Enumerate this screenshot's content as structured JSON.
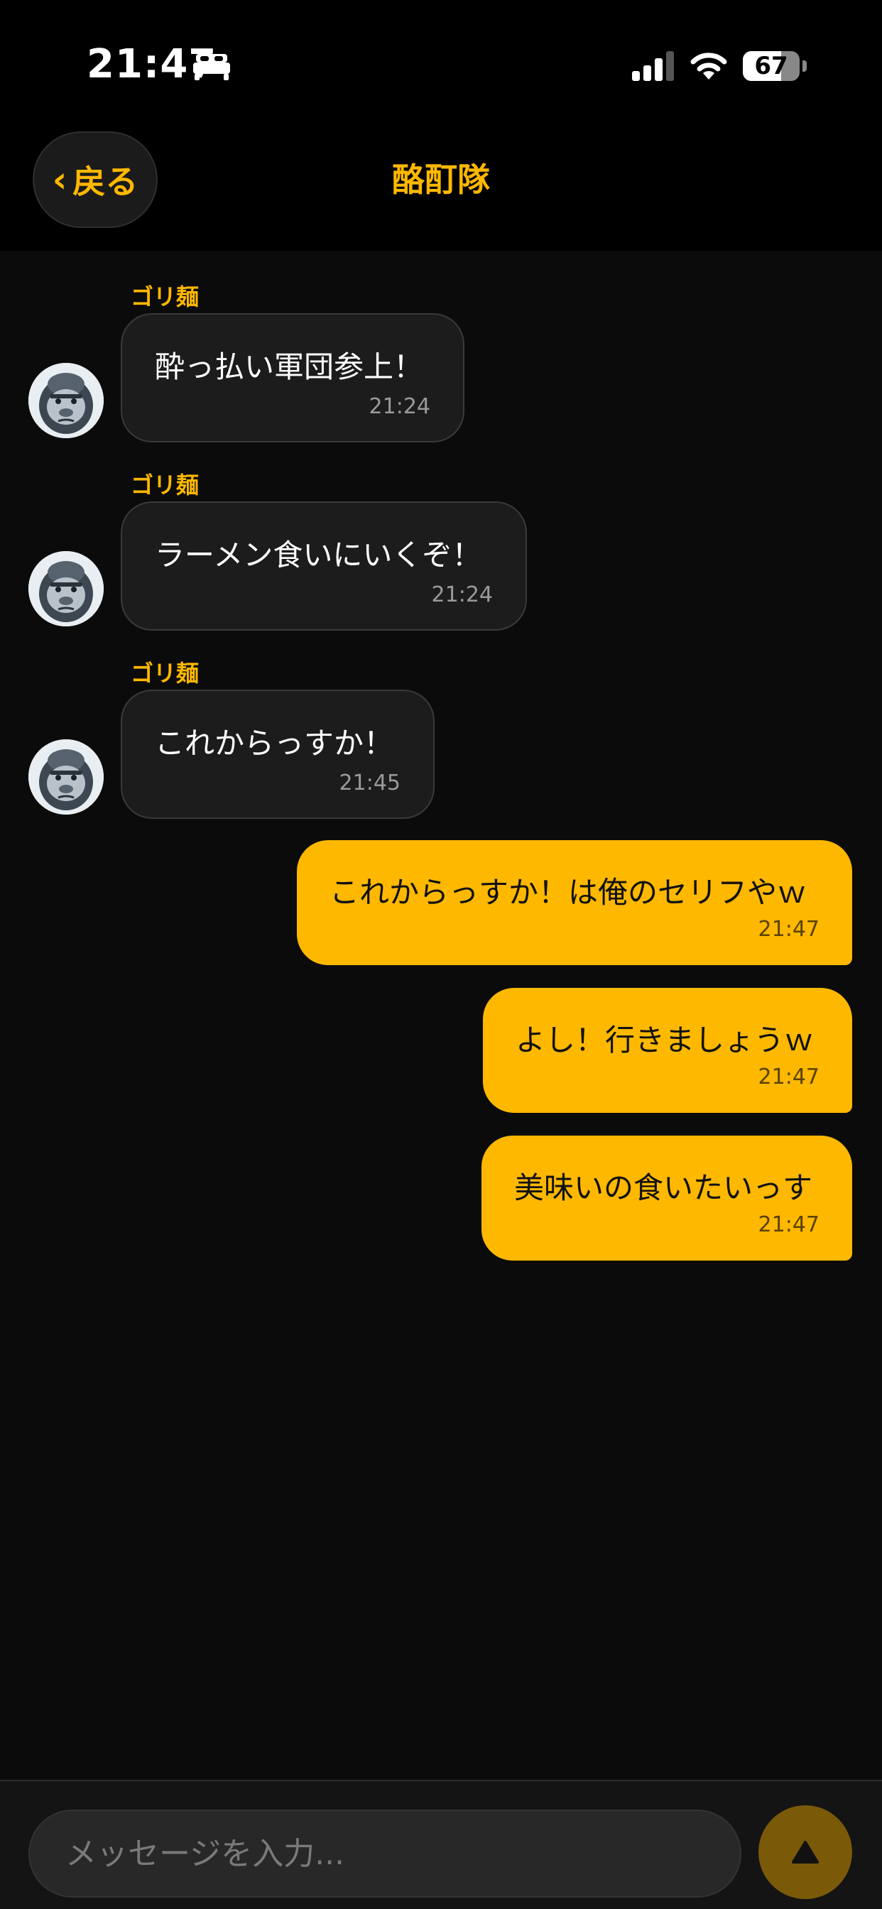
{
  "status_bar": {
    "time": "21:47",
    "battery_percent": "67",
    "battery_level": 0.67
  },
  "nav": {
    "back_label": "戻る",
    "title": "酪酊隊"
  },
  "messages": [
    {
      "sender": "ゴリ麺",
      "text": "酔っ払い軍団参上！",
      "time": "21:24"
    },
    {
      "sender": "ゴリ麺",
      "text": "ラーメン食いにいくぞ！",
      "time": "21:24"
    },
    {
      "sender": "ゴリ麺",
      "text": "これからっすか！",
      "time": "21:45"
    },
    {
      "text": "これからっすか！は俺のセリフやｗ",
      "time": "21:47"
    },
    {
      "text": "よし！行きましょうｗ",
      "time": "21:47"
    },
    {
      "text": "美味いの食いたいっす",
      "time": "21:47"
    }
  ],
  "input": {
    "placeholder": "メッセージを入力..."
  },
  "colors": {
    "accent": "#ffb800",
    "background": "#0b0b0b",
    "incoming_bubble": "#1c1c1c",
    "send_button": "#7a5a08"
  },
  "icons": {
    "sleep_focus": "bed-icon",
    "send": "send-icon",
    "back": "chevron-left-icon"
  }
}
